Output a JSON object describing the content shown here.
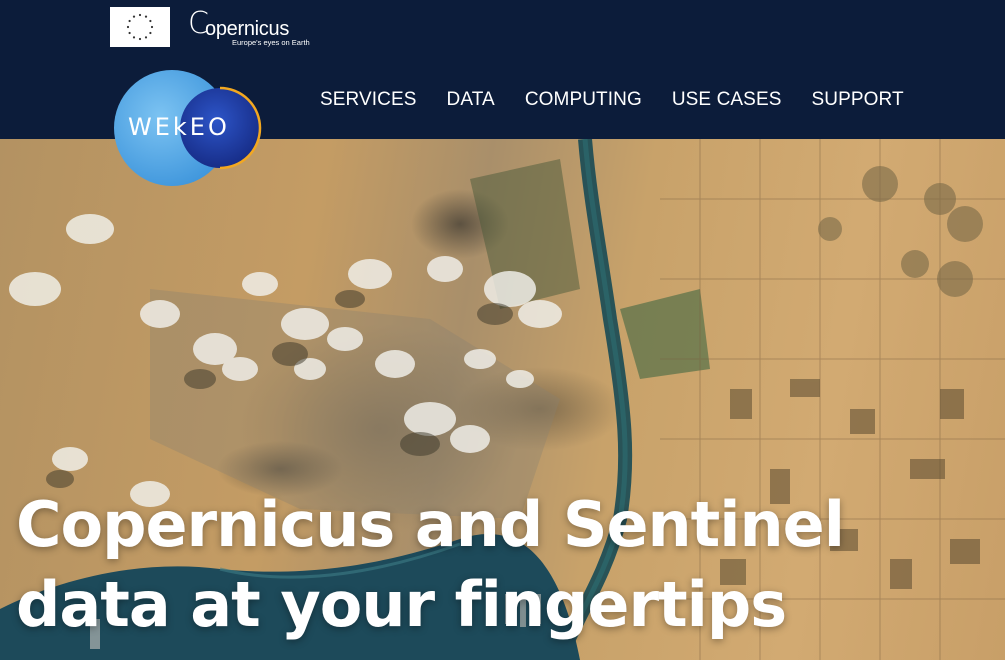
{
  "header": {
    "eu_logo_icon": "eu-flag-icon",
    "copernicus_logo": {
      "wordmark": "opernicus",
      "tagline": "Europe's eyes on Earth"
    },
    "wekeo_logo_text": "WEkEO",
    "nav": [
      {
        "label": "SERVICES"
      },
      {
        "label": "DATA"
      },
      {
        "label": "COMPUTING"
      },
      {
        "label": "USE CASES"
      },
      {
        "label": "SUPPORT"
      }
    ]
  },
  "hero": {
    "title": "Copernicus and Sentinel data at your fingertips",
    "background_image": "satellite-imagery"
  },
  "colors": {
    "header_bg": "#0c1c3a",
    "nav_text": "#ffffff",
    "wekeo_light_blue": "#5aaee8",
    "wekeo_dark_blue": "#1f3a9a"
  }
}
